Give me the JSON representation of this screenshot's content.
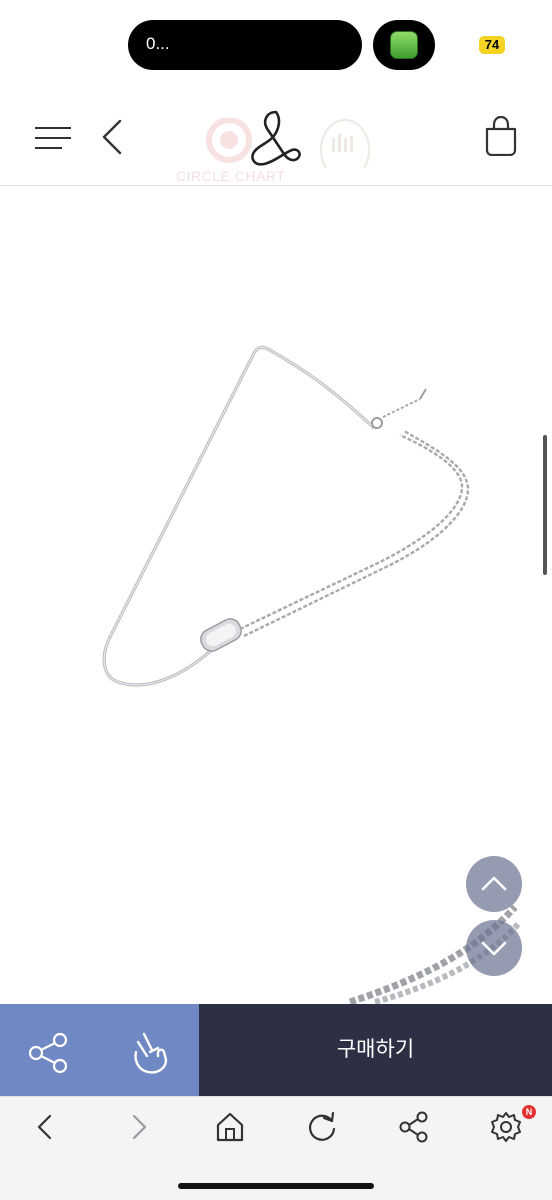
{
  "status_bar": {
    "island_text": "0...",
    "battery_level": "74"
  },
  "header": {
    "watermark_text": "CIRCLE CHART"
  },
  "product": {
    "image_description_icon": "silver-necklace-image"
  },
  "actions": {
    "share_icon": "share-icon",
    "hand_icon": "finger-heart-icon",
    "buy_label": "구매하기"
  },
  "browser_toolbar": {
    "icons": [
      "back-icon",
      "forward-icon",
      "home-icon",
      "refresh-icon",
      "share-icon",
      "settings-icon"
    ],
    "settings_badge": "N"
  },
  "colors": {
    "action_left_bg": "#7089c4",
    "buy_bg": "#2d3044",
    "fab_bg": "#6c7492",
    "battery_badge": "#f5d323",
    "notification_badge": "#e53030"
  }
}
